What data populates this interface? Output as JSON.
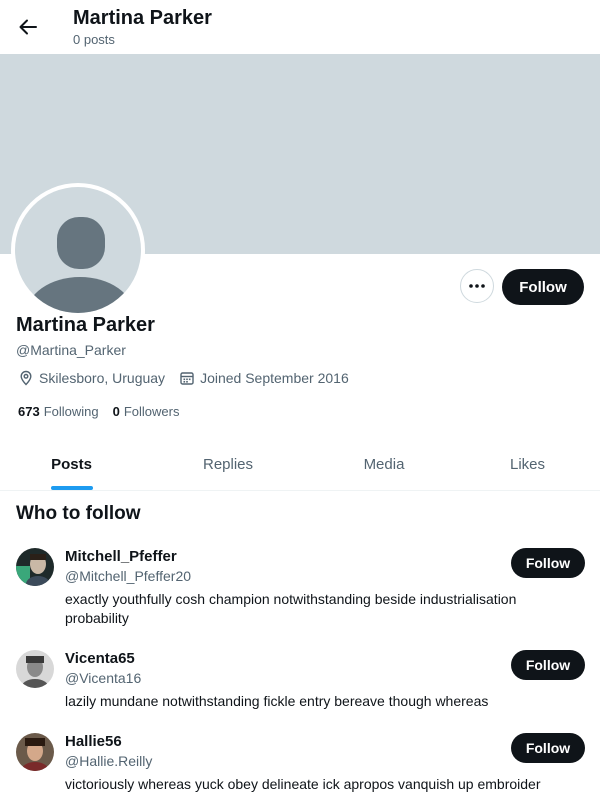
{
  "header": {
    "title": "Martina Parker",
    "subtitle": "0 posts"
  },
  "profile": {
    "name": "Martina Parker",
    "handle": "@Martina_Parker",
    "location": "Skilesboro, Uruguay",
    "joined": "Joined September 2016",
    "following_count": "673",
    "following_label": "Following",
    "followers_count": "0",
    "followers_label": "Followers",
    "follow_label": "Follow"
  },
  "tabs": [
    {
      "label": "Posts",
      "active": true
    },
    {
      "label": "Replies",
      "active": false
    },
    {
      "label": "Media",
      "active": false
    },
    {
      "label": "Likes",
      "active": false
    }
  ],
  "who_to_follow": {
    "title": "Who to follow",
    "users": [
      {
        "name": "Mitchell_Pfeffer",
        "handle": "@Mitchell_Pfeffer20",
        "bio": "exactly youthfully cosh champion notwithstanding beside industrialisation probability",
        "follow_label": "Follow"
      },
      {
        "name": "Vicenta65",
        "handle": "@Vicenta16",
        "bio": "lazily mundane notwithstanding fickle entry bereave though whereas",
        "follow_label": "Follow"
      },
      {
        "name": "Hallie56",
        "handle": "@Hallie.Reilly",
        "bio": "victoriously whereas yuck obey delineate ick apropos vanquish up embroider",
        "follow_label": "Follow"
      }
    ]
  },
  "colors": {
    "accent": "#1d9bf0",
    "banner": "#cfd9de",
    "button": "#0f1419",
    "muted": "#536471"
  }
}
